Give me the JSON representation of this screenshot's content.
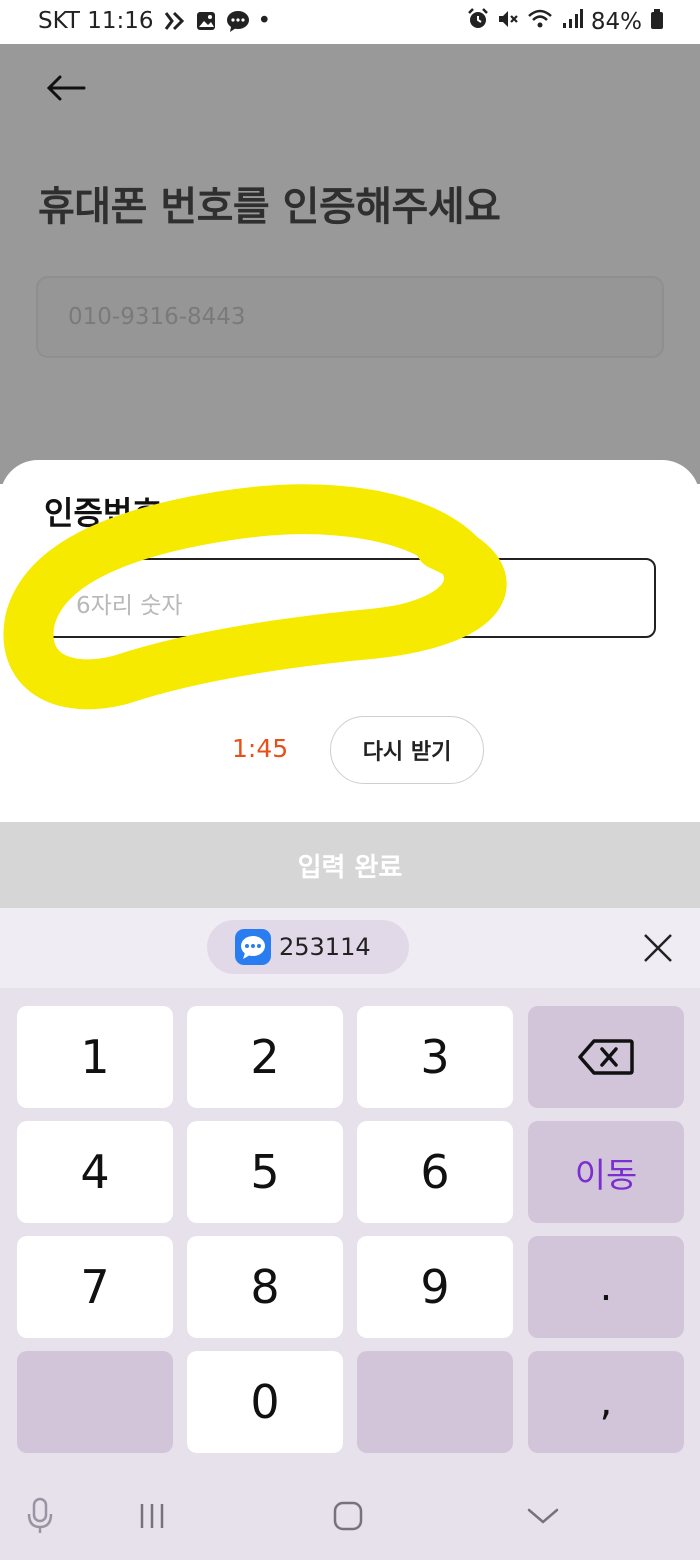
{
  "status_bar": {
    "carrier_time": "SKT 11:16",
    "dot": "•",
    "battery": "84%"
  },
  "page": {
    "title": "휴대폰 번호를 인증해주세요",
    "phone_value": "010-9316-8443"
  },
  "sheet": {
    "title": "인증번호",
    "code_placeholder": "6자리 숫자",
    "timer": "1:45",
    "resend_label": "다시 받기"
  },
  "done_button": "입력 완료",
  "keyboard": {
    "suggestion_code": "253114",
    "keys": {
      "k1": "1",
      "k2": "2",
      "k3": "3",
      "k4": "4",
      "k5": "5",
      "k6": "6",
      "k7": "7",
      "k8": "8",
      "k9": "9",
      "k0": "0",
      "move": "이동",
      "period": ".",
      "comma": ","
    }
  },
  "colors": {
    "timer": "#e8501a",
    "highlight": "#f5ea00",
    "key_accent": "#7b2fd0",
    "dim_overlay": "#999999"
  },
  "icons": [
    "back-arrow-icon",
    "backspace-icon",
    "close-icon",
    "messages-icon",
    "mic-icon",
    "recents-icon",
    "home-icon",
    "hide-keyboard-icon",
    "alarm-icon",
    "mute-icon",
    "wifi-icon",
    "signal-icon",
    "battery-icon"
  ]
}
